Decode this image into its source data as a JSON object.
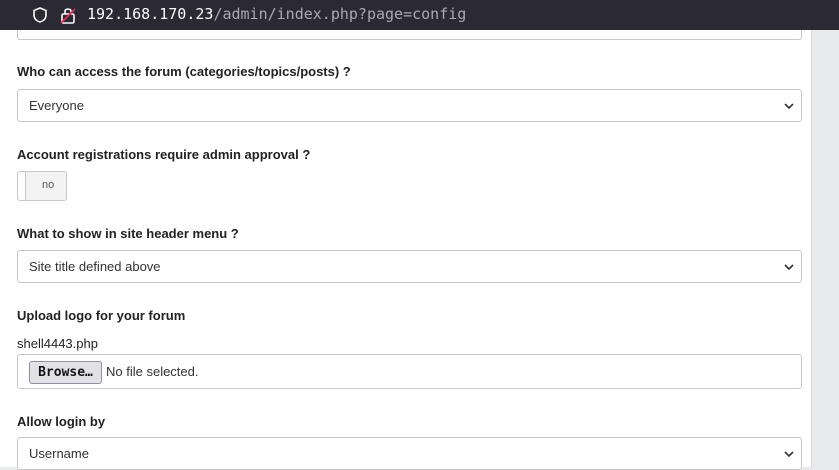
{
  "browser": {
    "url_host": "192.168.170.23",
    "url_path": "/admin/index.php?page=config"
  },
  "form": {
    "forum_access": {
      "label": "Who can access the forum (categories/topics/posts) ?",
      "value": "Everyone"
    },
    "registration_approval": {
      "label": "Account registrations require admin approval ?",
      "toggle_text": "no"
    },
    "header_menu": {
      "label": "What to show in site header menu ?",
      "value": "Site title defined above"
    },
    "logo_upload": {
      "label": "Upload logo for your forum",
      "current_file": "shell4443.php",
      "browse_label": "Browse…",
      "status": "No file selected."
    },
    "login_by": {
      "label": "Allow login by",
      "value": "Username"
    }
  }
}
